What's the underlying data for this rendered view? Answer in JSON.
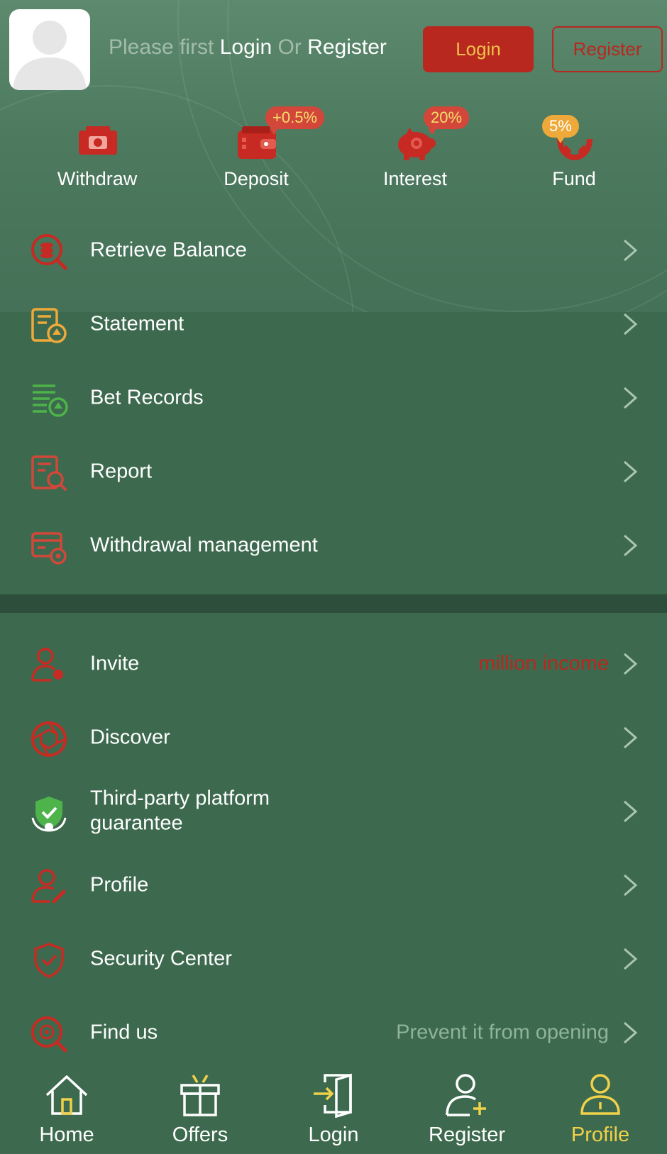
{
  "colors": {
    "background": "#3d6a4e",
    "header_bg": "#5d8a6e",
    "accent_red": "#b8281f",
    "accent_gold": "#f0c24a",
    "divider": "#2c4e3a",
    "muted_text": "#8fb39c",
    "active_tab": "#f0d14a"
  },
  "header": {
    "prompt_prefix": "Please first",
    "prompt_login": "Login",
    "prompt_or": "Or",
    "prompt_register": "Register",
    "login_button": "Login",
    "register_button": "Register"
  },
  "quick_actions": [
    {
      "label": "Withdraw",
      "icon": "withdraw-icon",
      "badge": ""
    },
    {
      "label": "Deposit",
      "icon": "wallet-icon",
      "badge": "+0.5%"
    },
    {
      "label": "Interest",
      "icon": "piggy-bank-icon",
      "badge": "20%"
    },
    {
      "label": "Fund",
      "icon": "fund-hands-icon",
      "badge": "5%"
    }
  ],
  "menu_group_1": [
    {
      "label": "Retrieve Balance",
      "icon": "retrieve-balance-icon"
    },
    {
      "label": "Statement",
      "icon": "statement-icon"
    },
    {
      "label": "Bet Records",
      "icon": "bet-records-icon"
    },
    {
      "label": "Report",
      "icon": "report-icon"
    },
    {
      "label": "Withdrawal management",
      "icon": "withdrawal-settings-icon"
    }
  ],
  "menu_group_2": [
    {
      "label": "Invite",
      "icon": "invite-user-icon",
      "extra": "million income"
    },
    {
      "label": "Discover",
      "icon": "discover-aperture-icon",
      "extra": ""
    },
    {
      "label": "Third-party platform guarantee",
      "icon": "shield-check-icon",
      "extra": ""
    },
    {
      "label": "Profile",
      "icon": "profile-edit-icon",
      "extra": ""
    },
    {
      "label": "Security Center",
      "icon": "security-shield-icon",
      "extra": ""
    },
    {
      "label": "Find us",
      "icon": "find-us-icon",
      "extra": "Prevent it from opening"
    }
  ],
  "tabbar": [
    {
      "label": "Home",
      "icon": "home-icon",
      "active": false
    },
    {
      "label": "Offers",
      "icon": "gift-icon",
      "active": false
    },
    {
      "label": "Login",
      "icon": "login-door-icon",
      "active": false
    },
    {
      "label": "Register",
      "icon": "register-user-icon",
      "active": false
    },
    {
      "label": "Profile",
      "icon": "profile-icon",
      "active": true
    }
  ]
}
